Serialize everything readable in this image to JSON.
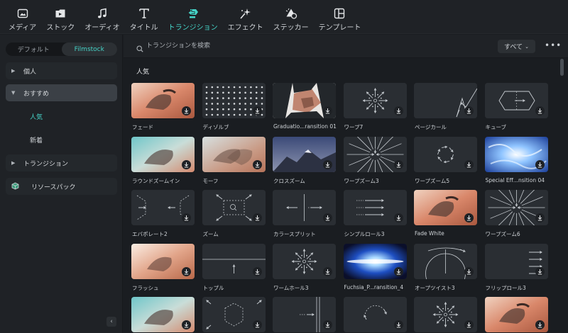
{
  "toolbar": {
    "items": [
      {
        "label": "メディア",
        "icon": "media-icon"
      },
      {
        "label": "ストック",
        "icon": "stock-icon"
      },
      {
        "label": "オーディオ",
        "icon": "music-note-icon"
      },
      {
        "label": "タイトル",
        "icon": "title-t-icon"
      },
      {
        "label": "トランジション",
        "icon": "transition-icon"
      },
      {
        "label": "エフェクト",
        "icon": "sparkle-icon"
      },
      {
        "label": "ステッカー",
        "icon": "sticker-icon"
      },
      {
        "label": "テンプレート",
        "icon": "template-icon"
      }
    ],
    "active_index": 4
  },
  "sidebar": {
    "tabs": [
      "デフォルト",
      "Filmstock"
    ],
    "active_tab": 1,
    "items": [
      {
        "label": "個人"
      },
      {
        "label": "おすすめ"
      },
      {
        "label": "人気"
      },
      {
        "label": "新着"
      },
      {
        "label": "トランジション"
      },
      {
        "label": "リソースパック"
      }
    ],
    "collapse_icon": "chevron-left-icon"
  },
  "search": {
    "placeholder": "トランジションを検索"
  },
  "filter": {
    "label": "すべて"
  },
  "section_title": "人気",
  "colors": {
    "accent": "#45d4c8",
    "panel": "#1f2226",
    "background": "#1a1d21"
  },
  "cards": [
    {
      "name": "フェード",
      "thumb": "photo"
    },
    {
      "name": "ディゾルブ",
      "thumb": "dots"
    },
    {
      "name": "Graduatio...ransition 01",
      "thumb": "iris"
    },
    {
      "name": "ワープ7",
      "thumb": "burst"
    },
    {
      "name": "ページカール",
      "thumb": "curl"
    },
    {
      "name": "キューブ",
      "thumb": "cube"
    },
    {
      "name": "ラウンドズームイン",
      "thumb": "photo-teal"
    },
    {
      "name": "モーフ",
      "thumb": "photo-morph"
    },
    {
      "name": "クロスズーム",
      "thumb": "mountain"
    },
    {
      "name": "ワープズーム3",
      "thumb": "rays"
    },
    {
      "name": "ワープズーム5",
      "thumb": "spiral"
    },
    {
      "name": "Special Eff...nsition 04",
      "thumb": "water"
    },
    {
      "name": "エバポレート2",
      "thumb": "evaporate"
    },
    {
      "name": "ズーム",
      "thumb": "zoom"
    },
    {
      "name": "カラースプリット",
      "thumb": "split"
    },
    {
      "name": "シンプルロール3",
      "thumb": "roll"
    },
    {
      "name": "Fade White",
      "thumb": "photo"
    },
    {
      "name": "ワープズーム6",
      "thumb": "rays"
    },
    {
      "name": "フラッシュ",
      "thumb": "photo-light"
    },
    {
      "name": "トップル",
      "thumb": "topple"
    },
    {
      "name": "ワームホール3",
      "thumb": "burst"
    },
    {
      "name": "Fuchsia_P...ransition_4",
      "thumb": "flare"
    },
    {
      "name": "オープツイスト3",
      "thumb": "twist"
    },
    {
      "name": "フリップロール3",
      "thumb": "fliproll"
    },
    {
      "name": "",
      "thumb": "photo-teal"
    },
    {
      "name": "",
      "thumb": "hex"
    },
    {
      "name": "",
      "thumb": "push"
    },
    {
      "name": "",
      "thumb": "circle"
    },
    {
      "name": "",
      "thumb": "burst"
    },
    {
      "name": "",
      "thumb": "photo"
    }
  ]
}
